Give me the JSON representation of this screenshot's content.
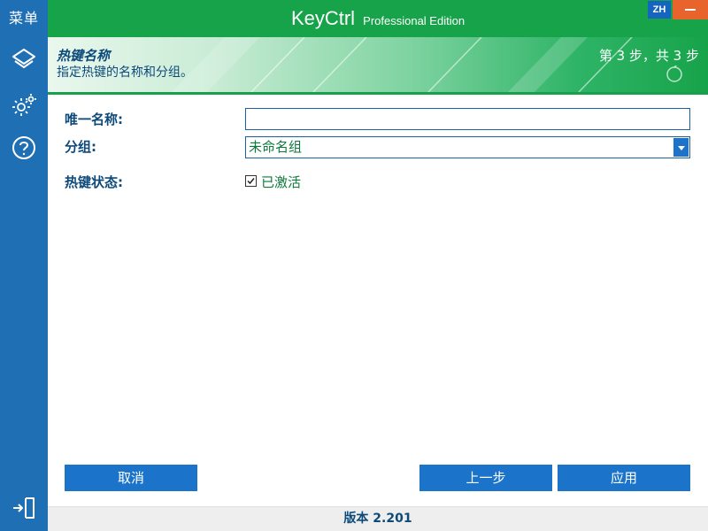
{
  "sidebar": {
    "menu_label": "菜单",
    "icons": [
      "layers-icon",
      "settings-icon",
      "help-icon",
      "exit-icon"
    ]
  },
  "titlebar": {
    "app_name": "KeyCtrl",
    "edition": "Professional Edition",
    "language": "ZH",
    "accent_color": "#17a34a",
    "close_color": "#e8642c"
  },
  "banner": {
    "title": "热键名称",
    "subtitle": "指定热键的名称和分组。",
    "step": "第 3 步，共 3 步"
  },
  "form": {
    "name_label": "唯一名称:",
    "name_value": "",
    "group_label": "分组:",
    "group_value": "未命名组",
    "status_label": "热键状态:",
    "active_checked": true,
    "active_label": "已激活"
  },
  "buttons": {
    "cancel": "取消",
    "back": "上一步",
    "apply": "应用",
    "color": "#1b74c9"
  },
  "footer": {
    "version": "版本 2.201"
  }
}
